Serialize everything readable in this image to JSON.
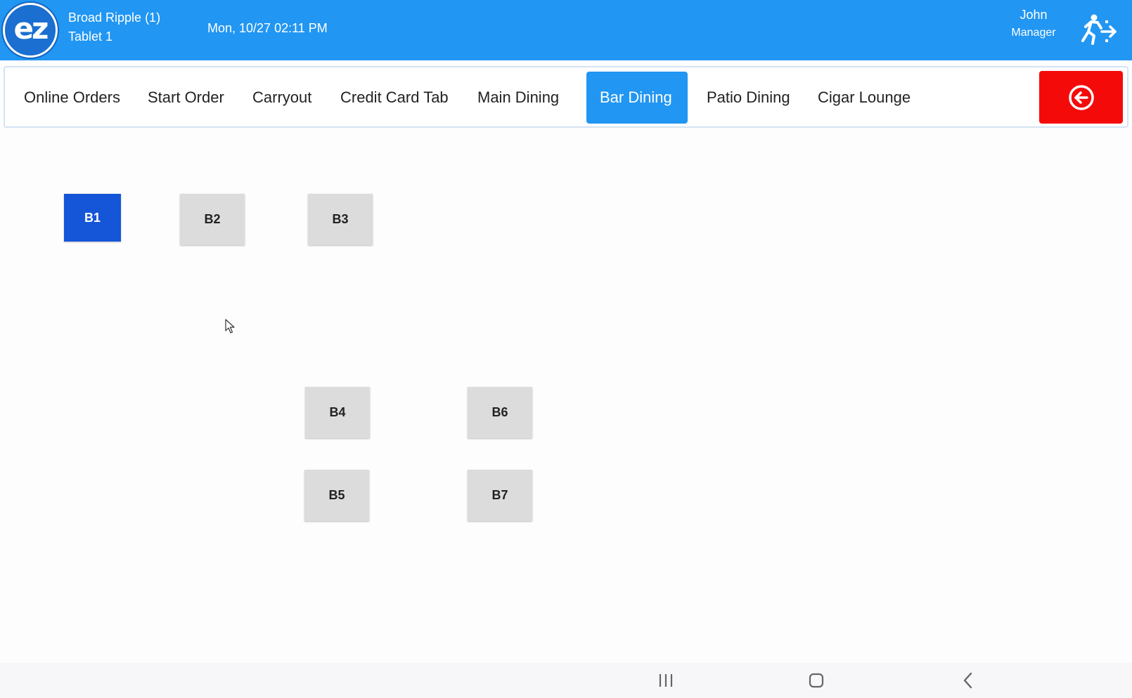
{
  "header": {
    "logo_text": "ez",
    "store_name": "Broad Ripple (1)",
    "device": "Tablet 1",
    "datetime": "Mon, 10/27 02:11 PM",
    "user_name": "John",
    "user_role": "Manager",
    "logout_icon": "exit-running-person-icon"
  },
  "tabs": [
    {
      "label": "Online Orders",
      "active": false
    },
    {
      "label": "Start Order",
      "active": false
    },
    {
      "label": "Carryout",
      "active": false
    },
    {
      "label": "Credit Card Tab",
      "active": false
    },
    {
      "label": "Main Dining",
      "active": false
    },
    {
      "label": "Bar Dining",
      "active": true
    },
    {
      "label": "Patio Dining",
      "active": false
    },
    {
      "label": "Cigar Lounge",
      "active": false
    }
  ],
  "back_button": {
    "icon": "circle-arrow-left-icon",
    "color": "#f50a0a"
  },
  "tables": [
    {
      "label": "B1",
      "status": "occupied"
    },
    {
      "label": "B2",
      "status": "available"
    },
    {
      "label": "B3",
      "status": "available"
    },
    {
      "label": "B4",
      "status": "available"
    },
    {
      "label": "B6",
      "status": "available"
    },
    {
      "label": "B5",
      "status": "available"
    },
    {
      "label": "B7",
      "status": "available"
    }
  ],
  "colors": {
    "header_bg": "#2196f3",
    "active_tab": "#2196f3",
    "occupied_table": "#1556d8",
    "available_table": "#dcdcdc"
  },
  "system_nav": {
    "recents_icon": "recents-icon",
    "home_icon": "home-icon",
    "back_icon": "back-chevron-icon"
  }
}
